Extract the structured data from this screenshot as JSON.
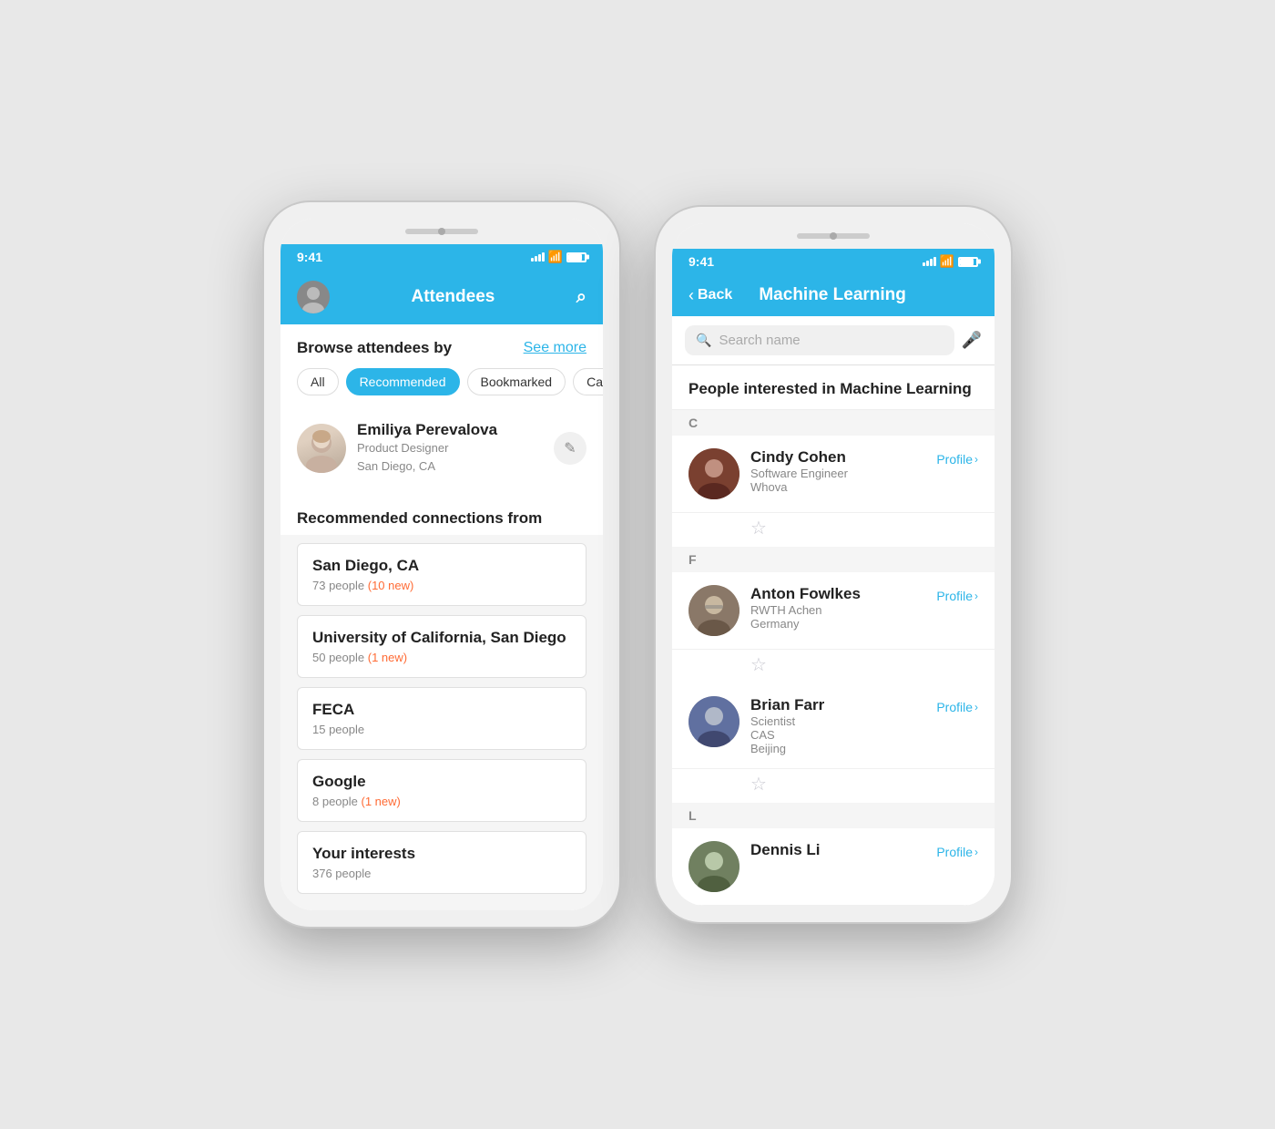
{
  "phone1": {
    "statusBar": {
      "time": "9:41"
    },
    "navBar": {
      "title": "Attendees"
    },
    "browseSection": {
      "title": "Browse attendees by",
      "seeMore": "See more"
    },
    "filterTabs": [
      {
        "label": "All",
        "active": false
      },
      {
        "label": "Recommended",
        "active": true
      },
      {
        "label": "Bookmarked",
        "active": false
      },
      {
        "label": "Categ…",
        "active": false
      }
    ],
    "currentUser": {
      "name": "Emiliya Perevalova",
      "title": "Product Designer",
      "location": "San Diego, CA"
    },
    "recommendedSection": {
      "title": "Recommended connections from"
    },
    "connectionCards": [
      {
        "title": "San Diego, CA",
        "people": "73 people",
        "newBadge": "(10 new)"
      },
      {
        "title": "University of California, San Diego",
        "people": "50 people",
        "newBadge": "(1 new)"
      },
      {
        "title": "FECA",
        "people": "15 people",
        "newBadge": null
      },
      {
        "title": "Google",
        "people": "8 people",
        "newBadge": "(1 new)"
      },
      {
        "title": "Your interests",
        "people": "376 people",
        "newBadge": null
      }
    ]
  },
  "phone2": {
    "statusBar": {
      "time": "9:41"
    },
    "navBar": {
      "backLabel": "Back",
      "title": "Machine Learning"
    },
    "searchBar": {
      "placeholder": "Search name"
    },
    "sectionTitle": "People interested in Machine Learning",
    "letterSections": [
      {
        "letter": "C",
        "people": [
          {
            "name": "Cindy Cohen",
            "job": "Software Engineer",
            "company": "Whova",
            "location": null,
            "profileLabel": "Profile"
          }
        ]
      },
      {
        "letter": "F",
        "people": [
          {
            "name": "Anton Fowlkes",
            "job": "RWTH Achen",
            "company": "Germany",
            "location": null,
            "profileLabel": "Profile"
          },
          {
            "name": "Brian Farr",
            "job": "Scientist",
            "company": "CAS",
            "location": "Beijing",
            "profileLabel": "Profile"
          }
        ]
      },
      {
        "letter": "L",
        "people": [
          {
            "name": "Dennis Li",
            "job": "",
            "company": "",
            "location": null,
            "profileLabel": "Profile"
          }
        ]
      }
    ]
  }
}
